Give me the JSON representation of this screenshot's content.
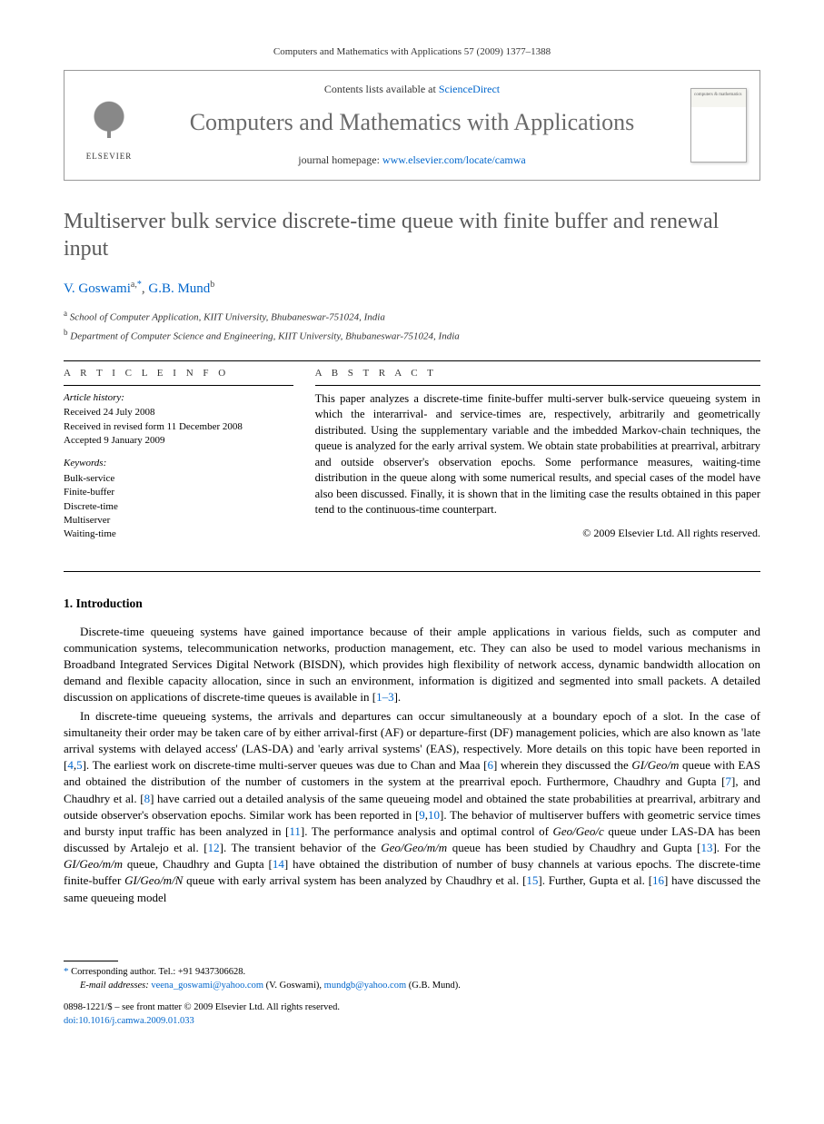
{
  "header": {
    "citation": "Computers and Mathematics with Applications 57 (2009) 1377–1388"
  },
  "masthead": {
    "contents_prefix": "Contents lists available at ",
    "contents_link": "ScienceDirect",
    "journal_name": "Computers and Mathematics with Applications",
    "homepage_prefix": "journal homepage: ",
    "homepage_link": "www.elsevier.com/locate/camwa",
    "publisher_logo": "ELSEVIER",
    "cover_text": "computers & mathematics"
  },
  "article": {
    "title": "Multiserver bulk service discrete-time queue with finite buffer and renewal input",
    "authors_html": "V. Goswami",
    "author1_name": "V. Goswami",
    "author1_sup": "a,",
    "author1_corr": "*",
    "sep": ", ",
    "author2_name": "G.B. Mund",
    "author2_sup": "b",
    "affiliations": [
      {
        "sup": "a",
        "text": " School of Computer Application, KIIT University, Bhubaneswar-751024, India"
      },
      {
        "sup": "b",
        "text": " Department of Computer Science and Engineering, KIIT University, Bhubaneswar-751024, India"
      }
    ]
  },
  "info": {
    "label": "A R T I C L E   I N F O",
    "history_heading": "Article history:",
    "history_lines": [
      "Received 24 July 2008",
      "Received in revised form 11 December 2008",
      "Accepted 9 January 2009"
    ],
    "keywords_heading": "Keywords:",
    "keywords": [
      "Bulk-service",
      "Finite-buffer",
      "Discrete-time",
      "Multiserver",
      "Waiting-time"
    ]
  },
  "abstract": {
    "label": "A B S T R A C T",
    "text": "This paper analyzes a discrete-time finite-buffer multi-server bulk-service queueing system in which the interarrival- and service-times are, respectively, arbitrarily and geometrically distributed. Using the supplementary variable and the imbedded Markov-chain techniques, the queue is analyzed for the early arrival system. We obtain state probabilities at prearrival, arbitrary and outside observer's observation epochs. Some performance measures, waiting-time distribution in the queue along with some numerical results, and special cases of the model have also been discussed. Finally, it is shown that in the limiting case the results obtained in this paper tend to the continuous-time counterpart.",
    "copyright": "© 2009 Elsevier Ltd. All rights reserved."
  },
  "section1": {
    "heading": "1.  Introduction"
  },
  "body": {
    "p1_a": "Discrete-time queueing systems have gained importance because of their ample applications in various fields, such as computer and communication systems, telecommunication networks, production management, etc. They can also be used to model various mechanisms in Broadband Integrated Services Digital Network (BISDN), which provides high flexibility of network access, dynamic bandwidth allocation on demand and flexible capacity allocation, since in such an environment, information is digitized and segmented into small packets. A detailed discussion on applications of discrete-time queues is available in [",
    "p1_ref": "1–3",
    "p1_b": "].",
    "p2_a": "In discrete-time queueing systems, the arrivals and departures can occur simultaneously at a boundary epoch of a slot. In the case of simultaneity their order may be taken care of by either arrival-first (AF) or departure-first (DF) management policies, which are also known as 'late arrival systems with delayed access' (LAS-DA) and 'early arrival systems' (EAS), respectively. More details on this topic have been reported in [",
    "p2_r1": "4",
    "p2_c1": ",",
    "p2_r2": "5",
    "p2_b": "]. The earliest work on discrete-time multi-server queues was due to Chan and Maa [",
    "p2_r3": "6",
    "p2_c": "] wherein they discussed the ",
    "p2_m1": "GI/Geo/m",
    "p2_d": " queue with EAS and obtained the distribution of the number of customers in the system at the prearrival epoch. Furthermore, Chaudhry and Gupta [",
    "p2_r4": "7",
    "p2_e": "], and Chaudhry et al. [",
    "p2_r5": "8",
    "p2_f": "] have carried out a detailed analysis of the same queueing model and obtained the state probabilities at prearrival, arbitrary and outside observer's observation epochs. Similar work has been reported in [",
    "p2_r6": "9",
    "p2_c2": ",",
    "p2_r7": "10",
    "p2_g": "]. The behavior of multiserver buffers with geometric service times and bursty input traffic has been analyzed in [",
    "p2_r8": "11",
    "p2_h": "]. The performance analysis and optimal control of ",
    "p2_m2": "Geo/Geo/c",
    "p2_i": " queue under LAS-DA has been discussed by Artalejo et al. [",
    "p2_r9": "12",
    "p2_j": "]. The transient behavior of the ",
    "p2_m3": "Geo/Geo/m/m",
    "p2_k": " queue has been studied by Chaudhry and Gupta [",
    "p2_r10": "13",
    "p2_l": "]. For the ",
    "p2_m4": "GI/Geo/m/m",
    "p2_m": " queue, Chaudhry and Gupta [",
    "p2_r11": "14",
    "p2_n": "] have obtained the distribution of number of busy channels at various epochs. The discrete-time finite-buffer ",
    "p2_m5": "GI/Geo/m/N",
    "p2_o": " queue with early arrival system has been analyzed by Chaudhry et al. [",
    "p2_r12": "15",
    "p2_p": "]. Further, Gupta et al. [",
    "p2_r13": "16",
    "p2_q": "] have discussed the same queueing model"
  },
  "footnotes": {
    "corr_sym": "*",
    "corr_label": " Corresponding author. Tel.: +91 9437306628.",
    "email_label": "E-mail addresses:",
    "email1": "veena_goswami@yahoo.com",
    "email1_who": " (V. Goswami), ",
    "email2": "mundgb@yahoo.com",
    "email2_who": " (G.B. Mund)."
  },
  "bottom": {
    "issn_line": "0898-1221/$ – see front matter © 2009 Elsevier Ltd. All rights reserved.",
    "doi_prefix": "doi:",
    "doi": "10.1016/j.camwa.2009.01.033"
  }
}
